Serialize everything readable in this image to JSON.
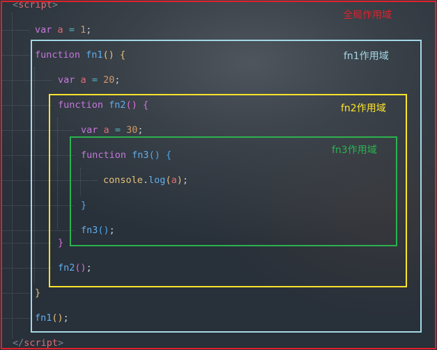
{
  "code": {
    "script_open": {
      "lt": "<",
      "name": "script",
      "gt": ">"
    },
    "script_close": {
      "lt": "</",
      "name": "script",
      "gt": ">"
    },
    "line_var_a1": {
      "kw": "var",
      "name": "a",
      "op": "=",
      "value": "1",
      "end": ";"
    },
    "line_fn1_def": {
      "kw": "function",
      "name": "fn1",
      "parens": "()",
      "brace": "{"
    },
    "line_var_a20": {
      "kw": "var",
      "name": "a",
      "op": "=",
      "value": "20",
      "end": ";"
    },
    "line_fn2_def": {
      "kw": "function",
      "name": "fn2",
      "parens": "()",
      "brace": "{"
    },
    "line_var_a30": {
      "kw": "var",
      "name": "a",
      "op": "=",
      "value": "30",
      "end": ";"
    },
    "line_fn3_def": {
      "kw": "function",
      "name": "fn3",
      "parens": "()",
      "brace": "{"
    },
    "line_console": {
      "obj": "console",
      "dot": ".",
      "method": "log",
      "open": "(",
      "arg": "a",
      "close": ")",
      "end": ";"
    },
    "line_fn3_close": {
      "brace": "}"
    },
    "line_fn3_call": {
      "name": "fn3",
      "parens": "()",
      "end": ";"
    },
    "line_fn2_close": {
      "brace": "}"
    },
    "line_fn2_call": {
      "name": "fn2",
      "parens": "()",
      "end": ";"
    },
    "line_fn1_close": {
      "brace": "}"
    },
    "line_fn1_call": {
      "name": "fn1",
      "parens": "()",
      "end": ";"
    }
  },
  "scopes": {
    "global": {
      "label": "全局作用域",
      "color": "#e0212b"
    },
    "fn1": {
      "label": "fn1作用域",
      "color": "#a4d8e6"
    },
    "fn2": {
      "label": "fn2作用域",
      "color": "#ffe52b"
    },
    "fn3": {
      "label": "fn3作用域",
      "color": "#2bb34f"
    }
  }
}
